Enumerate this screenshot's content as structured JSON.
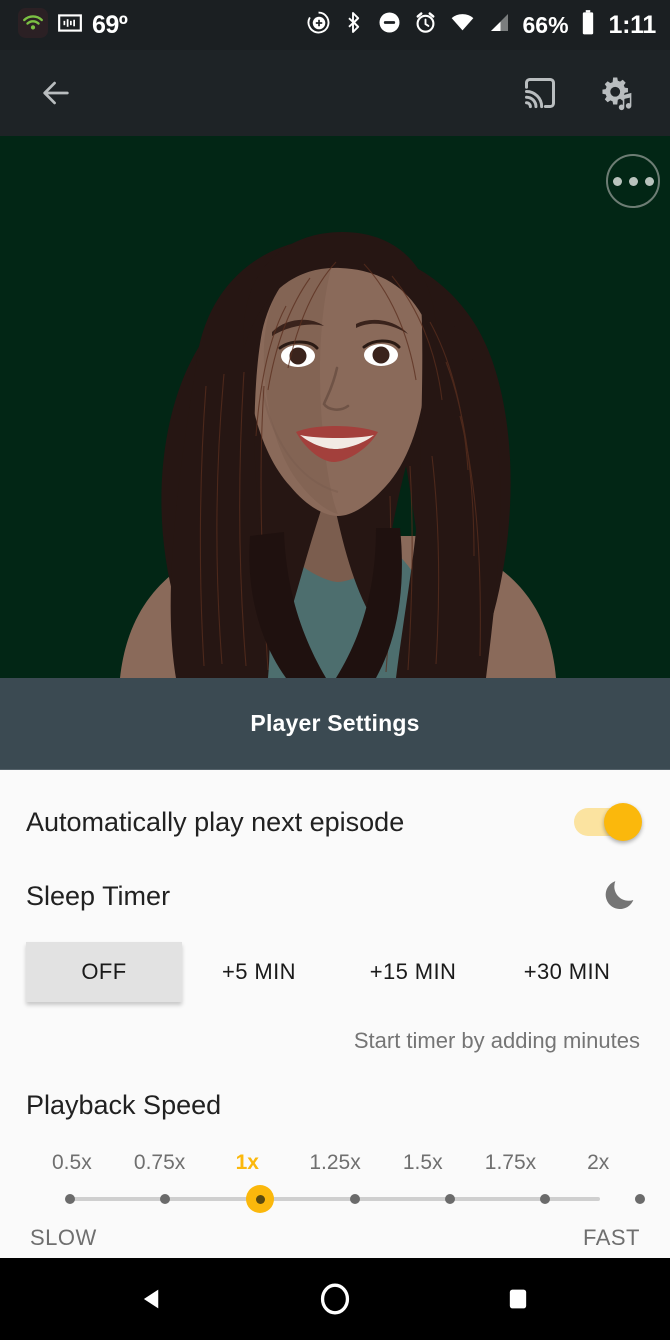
{
  "status_bar": {
    "temperature": "69º",
    "time": "1:11",
    "battery_percent": "66%",
    "icons_left": [
      "wifi-hotspot-icon",
      "soundwave-widget-icon"
    ],
    "icons_right": [
      "location-icon",
      "bluetooth-icon",
      "do-not-disturb-icon",
      "alarm-icon",
      "wifi-icon",
      "cellular-signal-icon",
      "battery-icon"
    ],
    "background_color": "#1b1f22"
  },
  "toolbar": {
    "back_label": "Back",
    "cast_label": "Cast",
    "audio_settings_label": "Audio settings",
    "background_color": "#1e2326"
  },
  "artwork": {
    "more_options_label": "More options",
    "background_color": "#022615",
    "skin_color": "#8a6a5a",
    "hair_color": "#261613",
    "shirt_color": "#4d6e6e",
    "lip_color": "#a3403c"
  },
  "sheet": {
    "title": "Player Settings",
    "header_color": "#3b4a52",
    "accent_color": "#fbb80c"
  },
  "settings": {
    "autoplay": {
      "label": "Automatically play next episode",
      "toggle_state": "on"
    },
    "sleep_timer": {
      "label": "Sleep Timer",
      "icon": "moon-icon",
      "options": [
        {
          "label": "OFF",
          "selected": true
        },
        {
          "label": "+5 MIN",
          "selected": false
        },
        {
          "label": "+15 MIN",
          "selected": false
        },
        {
          "label": "+30 MIN",
          "selected": false
        }
      ],
      "hint": "Start timer by adding minutes"
    },
    "playback_speed": {
      "label": "Playback Speed",
      "options": [
        "0.5x",
        "0.75x",
        "1x",
        "1.25x",
        "1.5x",
        "1.75x",
        "2x"
      ],
      "selected_index": 2,
      "selected_value": "1x",
      "min_label": "SLOW",
      "max_label": "FAST"
    }
  },
  "nav_bar": {
    "back_label": "Back",
    "home_label": "Home",
    "recents_label": "Recent apps",
    "background_color": "#000000"
  }
}
